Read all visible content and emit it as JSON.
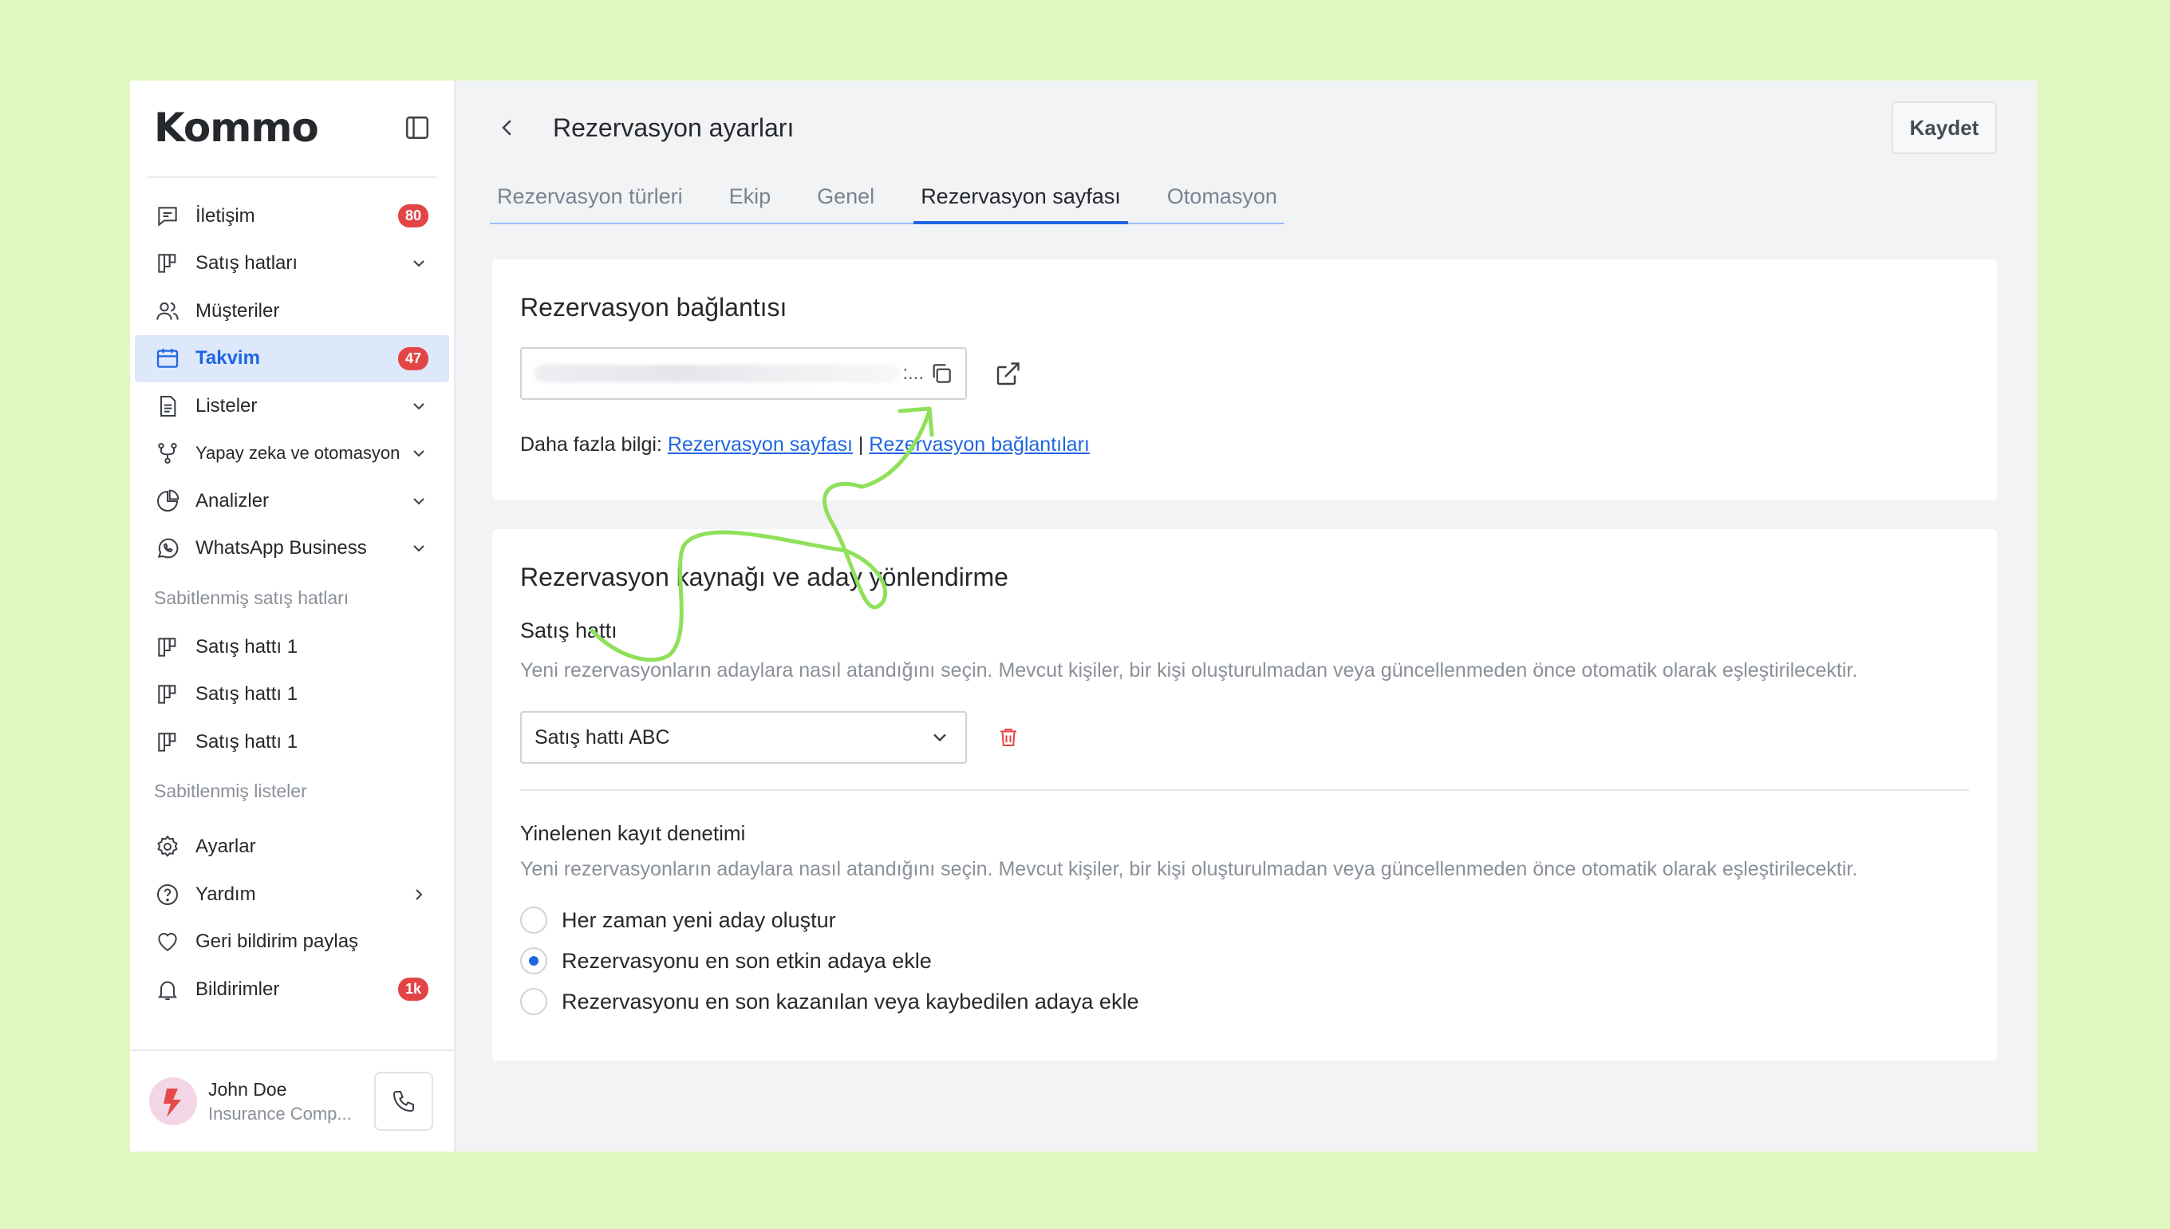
{
  "brand": {
    "logo": "Kommo"
  },
  "sidebar": {
    "items": [
      {
        "label": "İletişim",
        "icon": "chat-icon",
        "badge": "80"
      },
      {
        "label": "Satış hatları",
        "icon": "pipeline-icon"
      },
      {
        "label": "Müşteriler",
        "icon": "users-icon"
      },
      {
        "label": "Takvim",
        "icon": "calendar-icon",
        "badge": "47",
        "active": true
      },
      {
        "label": "Listeler",
        "icon": "list-icon"
      },
      {
        "label": "Yapay zeka ve otomasyon",
        "icon": "automation-icon"
      },
      {
        "label": "Analizler",
        "icon": "pie-chart-icon"
      },
      {
        "label": "WhatsApp Business",
        "icon": "whatsapp-icon"
      }
    ],
    "pinned_pipelines_label": "Sabitlenmiş satış hatları",
    "pinned_pipelines": [
      "Satış hattı 1",
      "Satış hattı 1",
      "Satış hattı 1"
    ],
    "pinned_lists_label": "Sabitlenmiş listeler",
    "bottom_items": [
      {
        "label": "Ayarlar",
        "icon": "gear-icon"
      },
      {
        "label": "Yardım",
        "icon": "help-icon"
      },
      {
        "label": "Geri bildirim paylaş",
        "icon": "heart-icon"
      },
      {
        "label": "Bildirimler",
        "icon": "bell-icon",
        "badge": "1k"
      }
    ],
    "user": {
      "name": "John Doe",
      "org": "Insurance Comp..."
    }
  },
  "header": {
    "title": "Rezervasyon ayarları",
    "save_label": "Kaydet",
    "tabs": [
      "Rezervasyon türleri",
      "Ekip",
      "Genel",
      "Rezervasyon sayfası",
      "Otomasyon"
    ],
    "active_tab": "Rezervasyon sayfası"
  },
  "booking_link": {
    "title": "Rezervasyon bağlantısı",
    "field_suffix": ":...",
    "more_info_prefix": "Daha fazla bilgi:",
    "link1": "Rezervasyon sayfası",
    "separator": "|",
    "link2": "Rezervasyon bağlantıları"
  },
  "routing": {
    "title": "Rezervasyon kaynağı ve aday yönlendirme",
    "pipeline_label": "Satış hattı",
    "pipeline_desc": "Yeni rezervasyonların adaylara nasıl atandığını seçin. Mevcut kişiler, bir kişi oluşturulmadan veya güncellenmeden önce otomatik olarak eşleştirilecektir.",
    "pipeline_value": "Satış hattı ABC",
    "dup_label": "Yinelenen kayıt denetimi",
    "dup_desc": "Yeni rezervasyonların adaylara nasıl atandığını seçin. Mevcut kişiler, bir kişi oluşturulmadan veya güncellenmeden önce otomatik olarak eşleştirilecektir.",
    "options": [
      "Her zaman yeni aday oluştur",
      "Rezervasyonu en son etkin adaya ekle",
      "Rezervasyonu en son kazanılan veya kaybedilen adaya ekle"
    ],
    "selected_option_index": 1
  },
  "colors": {
    "accent": "#1f66e0",
    "badge": "#e24545",
    "background": "#e1f7c1",
    "annotation": "#8fe05a"
  }
}
